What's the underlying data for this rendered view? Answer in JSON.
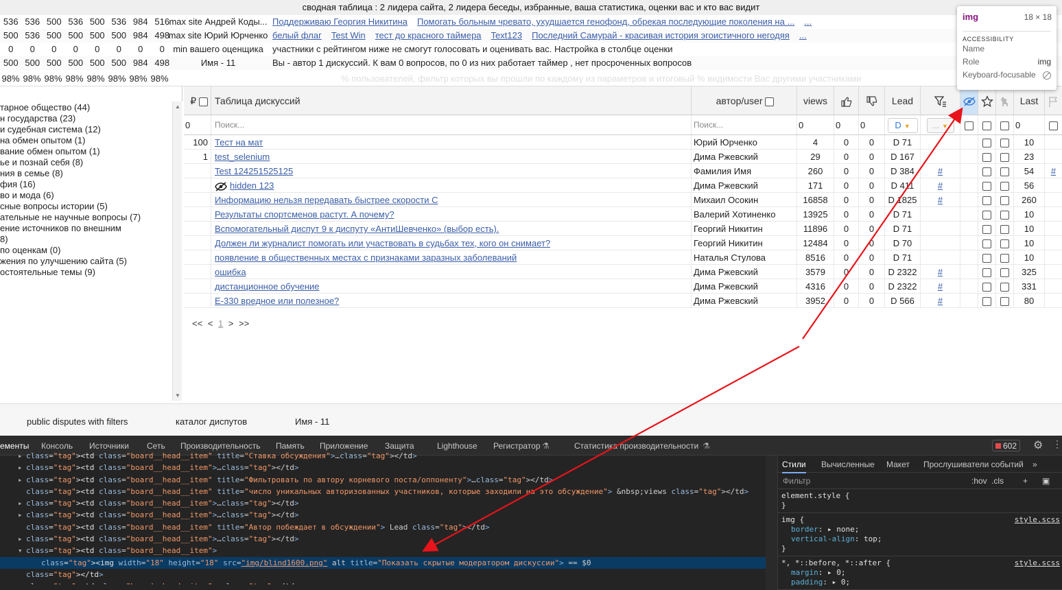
{
  "header": {
    "title": "сводная таблица : 2 лидера сайта, 2 лидера беседы, избранные, ваша статистика, оценки вас и кто вас видит"
  },
  "stats": [
    {
      "nums": [
        "536",
        "536",
        "500",
        "536",
        "500",
        "536",
        "984",
        "516"
      ],
      "who": "max site Андрей Коды...",
      "links": [
        "Поддерживаю Георгия Никитина",
        "Помогать больным чревато, ухудшается генофонд, обрекая последующие поколения на ...",
        "..."
      ],
      "text": ""
    },
    {
      "nums": [
        "500",
        "536",
        "500",
        "500",
        "500",
        "500",
        "984",
        "498"
      ],
      "who": "max site Юрий Юрченко",
      "links": [
        "белый флаг",
        "Test Win",
        "тест до красного таймера",
        "Text123",
        "Последний Самурай - красивая история эгоистичного негодяя",
        "..."
      ],
      "text": ""
    },
    {
      "nums": [
        "0",
        "0",
        "0",
        "0",
        "0",
        "0",
        "0",
        "0"
      ],
      "who": "min вашего оценщика",
      "links": [],
      "text": "участники с рейтингом ниже не смогут голосовать и оценивать вас. Настройка в столбце оценки"
    },
    {
      "nums": [
        "500",
        "500",
        "500",
        "500",
        "500",
        "500",
        "984",
        "498"
      ],
      "who": "Имя - 11",
      "links": [],
      "text": "Вы - автор 1 дискуссий. К вам 0 вопросов, по 0 из них работает таймер , нет просроченных вопросов"
    }
  ],
  "pct": {
    "nums": [
      "98%",
      "98%",
      "98%",
      "98%",
      "98%",
      "98%",
      "98%",
      "98%"
    ],
    "text": "% пользователей, фильтр которых вы прошли по каждому из параметров и итоговый % видимости Вас другими участниками"
  },
  "categories": [
    "тарное общество (44)",
    "н государства (23)",
    "и судебная система (12)",
    "на обмен опытом (1)",
    "вание обмен опытом (1)",
    "ье и познай себя (8)",
    "ния в семье (8)",
    "фия (16)",
    "во и мода (6)",
    "сные вопросы истории (5)",
    "ательные не научные вопросы (7)",
    "ение источников по внешним",
    "8)",
    "по оценкам (0)",
    "жения по улучшению сайта (5)",
    "остоятельные темы (9)"
  ],
  "table": {
    "head": {
      "currency": "₽",
      "discussions": "Таблица дискуссий",
      "author": "автор/user",
      "views": "views",
      "lead": "Lead",
      "last": "Last"
    },
    "filter": {
      "rating": "0",
      "search_placeholder": "Поиск...",
      "author_placeholder": "Поиск...",
      "views": "0",
      "likes": "0",
      "dislikes": "0",
      "lead_value": "D",
      "dots": "...",
      "last": "0"
    },
    "rows": [
      {
        "rating": "100",
        "title": "Тест на мат",
        "author": "Юрий Юрченко",
        "views": "4",
        "likes": "0",
        "dislikes": "0",
        "lead": "D 71",
        "hash": "",
        "last": "10",
        "hidden": false,
        "hashlast": ""
      },
      {
        "rating": "1",
        "title": "test_selenium",
        "author": "Дима Ржевский",
        "views": "29",
        "likes": "0",
        "dislikes": "0",
        "lead": "D 167",
        "hash": "",
        "last": "23",
        "hidden": false,
        "hashlast": ""
      },
      {
        "rating": "",
        "title": "Test 124251525125",
        "author": "Фамилия Имя",
        "views": "260",
        "likes": "0",
        "dislikes": "0",
        "lead": "D 384",
        "hash": "#",
        "last": "54",
        "hidden": false,
        "hashlast": "#"
      },
      {
        "rating": "",
        "title": "hidden 123",
        "author": "Дима Ржевский",
        "views": "171",
        "likes": "0",
        "dislikes": "0",
        "lead": "D 411",
        "hash": "#",
        "last": "56",
        "hidden": true,
        "hashlast": ""
      },
      {
        "rating": "",
        "title": "Информацию нельзя передавать быстрее скорости С",
        "author": "Михаил Осокин",
        "views": "16858",
        "likes": "0",
        "dislikes": "0",
        "lead": "D 1825",
        "hash": "#",
        "last": "260",
        "hidden": false,
        "hashlast": ""
      },
      {
        "rating": "",
        "title": "Результаты спортсменов растут. А почему?",
        "author": "Валерий Хотиненко",
        "views": "13925",
        "likes": "0",
        "dislikes": "0",
        "lead": "D 71",
        "hash": "",
        "last": "10",
        "hidden": false,
        "hashlast": ""
      },
      {
        "rating": "",
        "title": "Вспомогательный диспут 9 к диспуту «АнтиШевченко» (выбор есть).",
        "author": "Георгий Никитин",
        "views": "11896",
        "likes": "0",
        "dislikes": "0",
        "lead": "D 71",
        "hash": "",
        "last": "10",
        "hidden": false,
        "hashlast": ""
      },
      {
        "rating": "",
        "title": "Должен ли журналист помогать или участвовать в судьбах тех, кого он снимает?",
        "author": "Георгий Никитин",
        "views": "12484",
        "likes": "0",
        "dislikes": "0",
        "lead": "D 70",
        "hash": "",
        "last": "10",
        "hidden": false,
        "hashlast": ""
      },
      {
        "rating": "",
        "title": "появление в общественных местах с признаками заразных заболеваний",
        "author": "Наталья Стулова",
        "views": "8516",
        "likes": "0",
        "dislikes": "0",
        "lead": "D 71",
        "hash": "",
        "last": "10",
        "hidden": false,
        "hashlast": ""
      },
      {
        "rating": "",
        "title": "ошибка",
        "author": "Дима Ржевский",
        "views": "3579",
        "likes": "0",
        "dislikes": "0",
        "lead": "D 2322",
        "hash": "#",
        "last": "325",
        "hidden": false,
        "hashlast": ""
      },
      {
        "rating": "",
        "title": "дистанционное обучение",
        "author": "Дима Ржевский",
        "views": "4316",
        "likes": "0",
        "dislikes": "0",
        "lead": "D 2322",
        "hash": "#",
        "last": "331",
        "hidden": false,
        "hashlast": ""
      },
      {
        "rating": "",
        "title": "Е-330 вредное или полезное?",
        "author": "Дима Ржевский",
        "views": "3952",
        "likes": "0",
        "dislikes": "0",
        "lead": "D 566",
        "hash": "#",
        "last": "80",
        "hidden": false,
        "hashlast": ""
      }
    ],
    "pager": {
      "first": "<<",
      "prev": "<",
      "current": "1",
      "next": ">",
      "last": ">>"
    }
  },
  "bottom_tabs": [
    "public disputes with filters",
    "каталог диспутов",
    "Имя - 11"
  ],
  "devtools": {
    "tabs": [
      "ементы",
      "Консоль",
      "Источники",
      "Сеть",
      "Производительность",
      "Память",
      "Приложение",
      "Защита",
      "Lighthouse",
      "Регистратор",
      "Статистика производительности"
    ],
    "issues_count": "602",
    "code_lines": [
      {
        "tri": "▸",
        "indent": 0,
        "html": "<td class=\"board__head__item\" title=\"Ставка обсуждения\">…</td>",
        "sel": false
      },
      {
        "tri": "▸",
        "indent": 0,
        "html": "<td class=\"board__head__item\">…</td>",
        "sel": false
      },
      {
        "tri": "▸",
        "indent": 0,
        "html": "<td class=\"board__head__item\" title=\"Фильтровать по автору корневого поста/оппоненту\">…</td>",
        "sel": false
      },
      {
        "tri": " ",
        "indent": 0,
        "html": "<td class=\"board__head__item\" title=\"число уникальных авторизованных участников, которые заходили на это обсуждение\"> &nbsp;views </td>",
        "sel": false
      },
      {
        "tri": "▸",
        "indent": 0,
        "html": "<td class=\"board__head__item\">…</td>",
        "sel": false
      },
      {
        "tri": "▸",
        "indent": 0,
        "html": "<td class=\"board__head__item\">…</td>",
        "sel": false
      },
      {
        "tri": " ",
        "indent": 0,
        "html": "<td class=\"board__head__item\" title=\"Автор побеждает в обсуждении\"> Lead </td>",
        "sel": false
      },
      {
        "tri": "▸",
        "indent": 0,
        "html": "<td class=\"board__head__item\">…</td>",
        "sel": false
      },
      {
        "tri": "▾",
        "indent": 0,
        "html": "<td class=\"board__head__item\">",
        "sel": false
      },
      {
        "tri": " ",
        "indent": 1,
        "html": "<img width=\"18\" height=\"18\" src=\"img/blind1600.png\" alt title=\"Показать скрытые модератором дискуссии\"> == $0",
        "sel": true
      },
      {
        "tri": " ",
        "indent": 0,
        "html": "</td>",
        "sel": false
      },
      {
        "tri": "▸",
        "indent": 0,
        "html": "<td class=\"board__head__item\">…</td>",
        "sel": false
      }
    ],
    "styles_tabs": [
      "Стили",
      "Вычисленные",
      "Макет",
      "Прослушиватели событий"
    ],
    "filter_placeholder": "Фильтр",
    "filter_hov": ":hov",
    "filter_cls": ".cls",
    "rule1": "element.style {",
    "rule2_sel": "img {",
    "rule2_src": "style.scss",
    "rule2_p1": "border",
    "rule2_v1": "none;",
    "rule2_p2": "vertical-align",
    "rule2_v2": "top;",
    "rule3_sel": "*, *::before, *::after {",
    "rule3_src": "style.scss",
    "rule3_p1": "margin",
    "rule3_v1": "0;",
    "rule3_p2": "padding",
    "rule3_v2": "0;"
  },
  "tooltip": {
    "tag": "img",
    "size": "18 × 18",
    "section": "ACCESSIBILITY",
    "name_label": "Name",
    "role_label": "Role",
    "role_value": "img",
    "focus_label": "Keyboard-focusable"
  },
  "annotation_color": "#e8141b"
}
